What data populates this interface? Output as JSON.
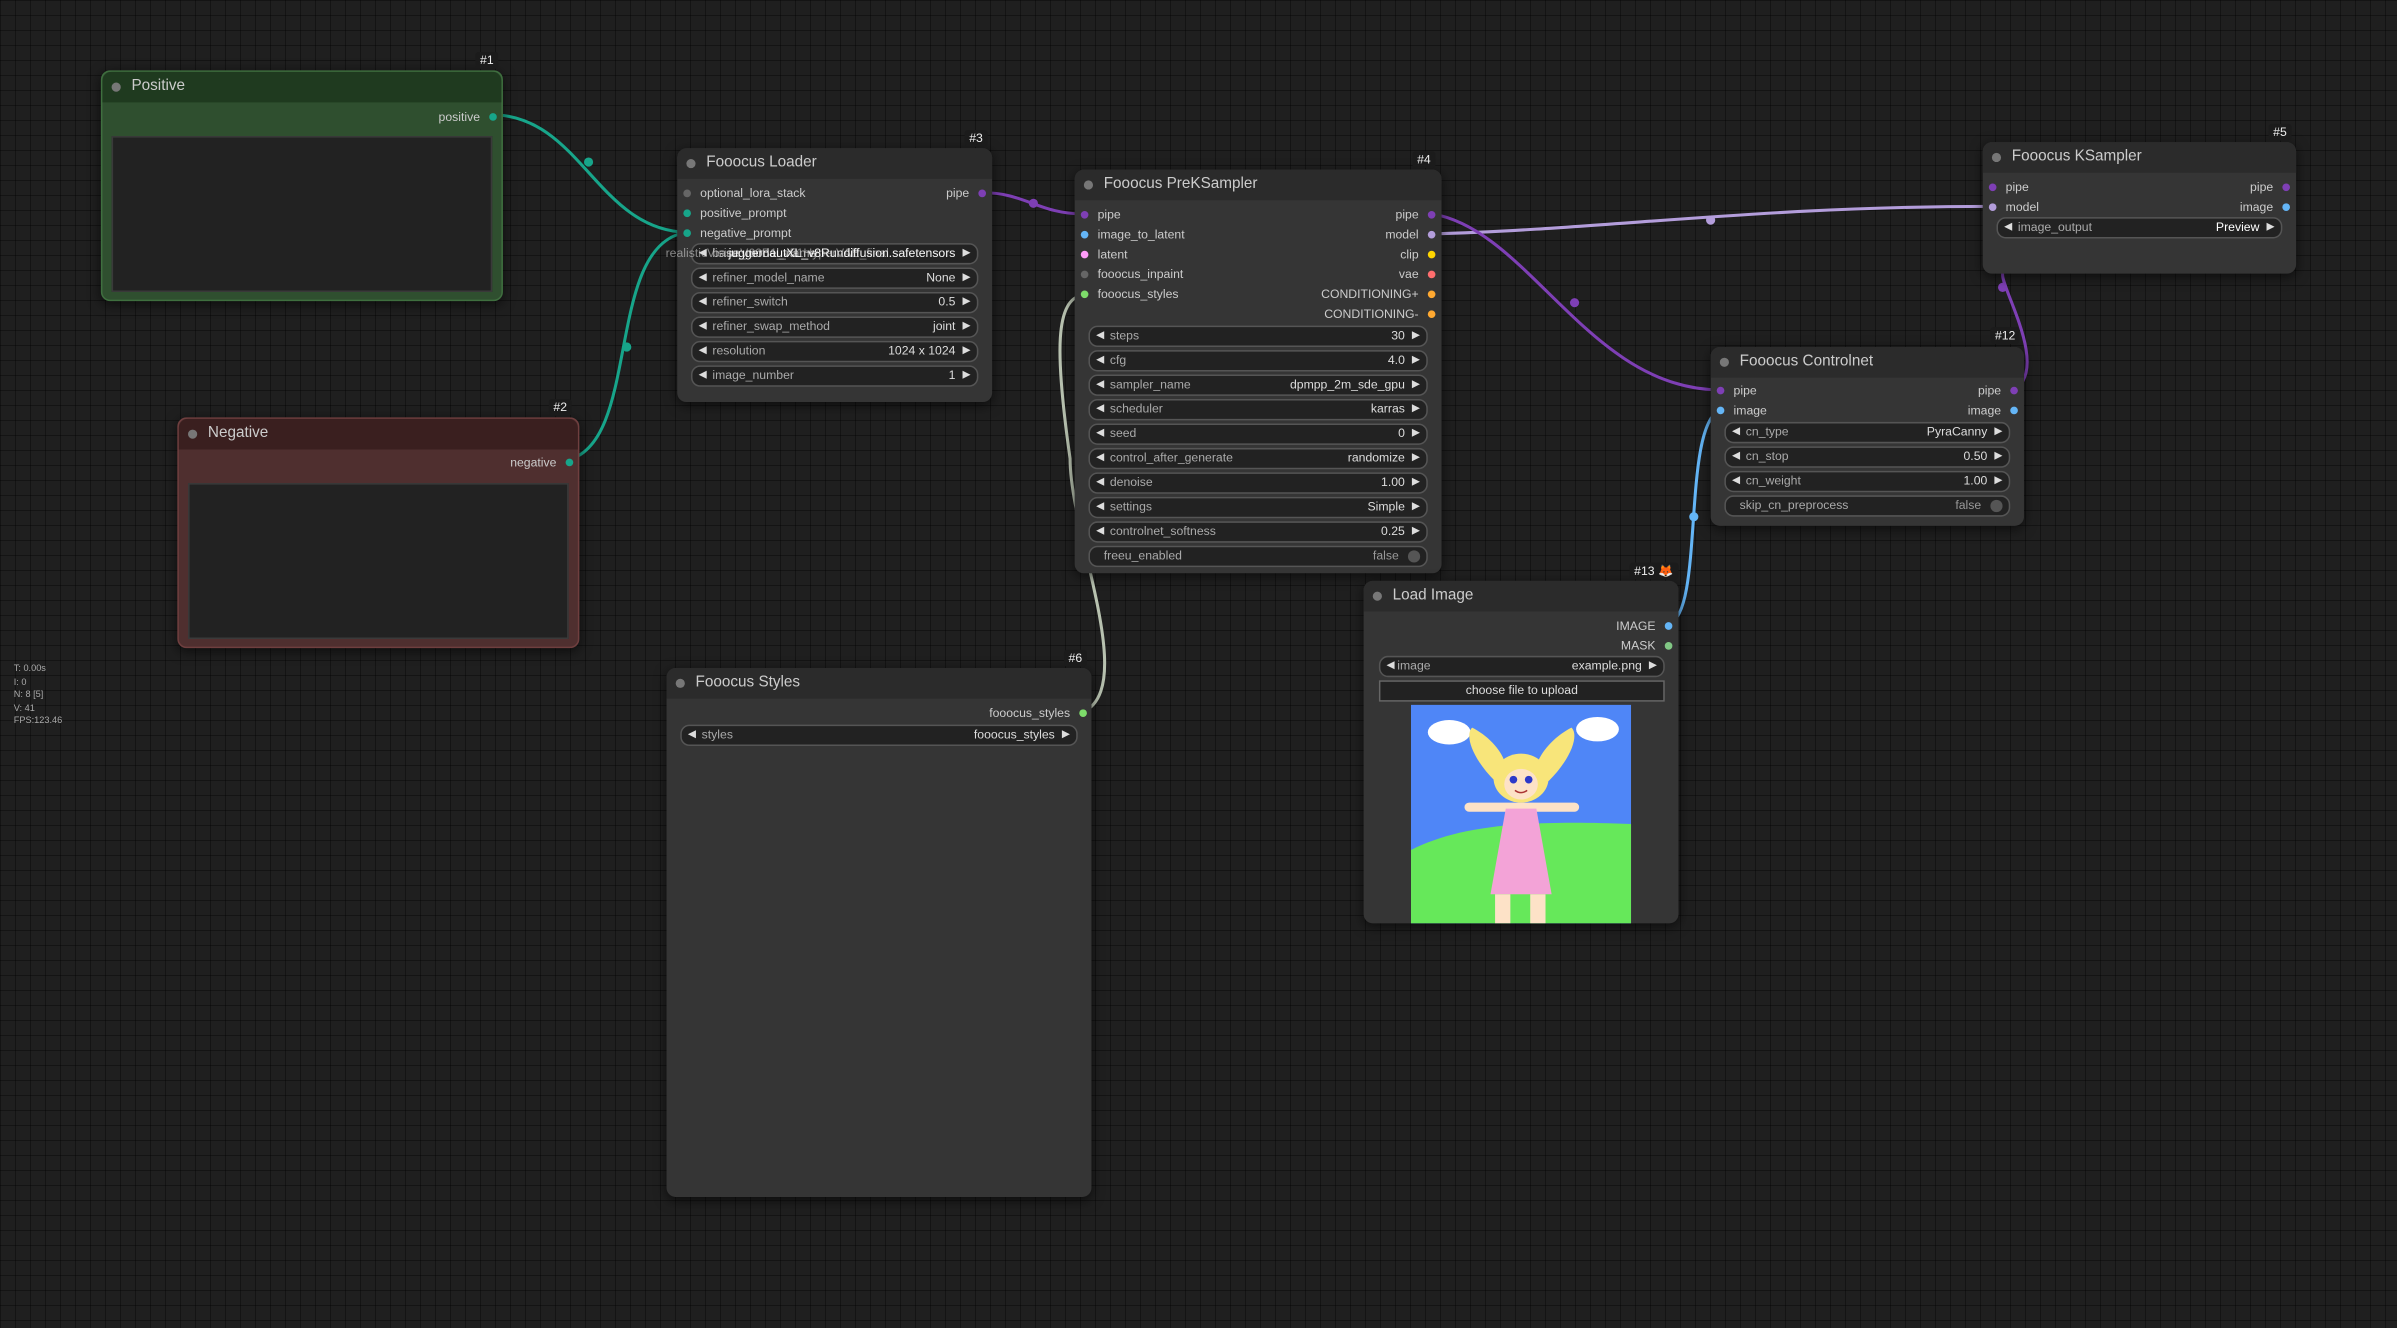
{
  "stats": [
    "T: 0.00s",
    "I: 0",
    "N: 8 [5]",
    "V: 41",
    "FPS:123.46"
  ],
  "colors": {
    "canvas": "#1f1f1f",
    "node": "#353535",
    "title": "#2b2b2b",
    "link_clip": "#17a58a",
    "link_pipe": "#7e3fb5",
    "link_model": "#b39ddb",
    "link_image": "#64b5f6",
    "link_styles": "#b8c2b0",
    "positive": "#2f4f2f",
    "negative": "#4f2f2f"
  },
  "nodes": {
    "positive": {
      "id": "#1",
      "title": "Positive",
      "outputs": [
        "positive"
      ]
    },
    "negative": {
      "id": "#2",
      "title": "Negative",
      "outputs": [
        "negative"
      ]
    },
    "loader": {
      "id": "#3",
      "title": "Fooocus Loader",
      "inputs": [
        "optional_lora_stack",
        "positive_prompt",
        "negative_prompt"
      ],
      "outputs": [
        "pipe"
      ],
      "widgets": [
        {
          "name": "base_model_name",
          "value": "juggernautXL_v8Rundiffusion.safetensors"
        },
        {
          "name": "refiner_model_name",
          "value": "None"
        },
        {
          "name": "refiner_switch",
          "value": "0.5"
        },
        {
          "name": "refiner_swap_method",
          "value": "joint"
        },
        {
          "name": "resolution",
          "value": "1024 x 1024"
        },
        {
          "name": "image_number",
          "value": "1"
        }
      ],
      "overlap_text": "realisticVisionV60B1_v51HyperVAE_final.safetensors"
    },
    "preksampler": {
      "id": "#4",
      "title": "Fooocus PreKSampler",
      "inputs": [
        "pipe",
        "image_to_latent",
        "latent",
        "fooocus_inpaint",
        "fooocus_styles"
      ],
      "outputs": [
        "pipe",
        "model",
        "clip",
        "vae",
        "CONDITIONING+",
        "CONDITIONING-"
      ],
      "widgets": [
        {
          "name": "steps",
          "value": "30"
        },
        {
          "name": "cfg",
          "value": "4.0"
        },
        {
          "name": "sampler_name",
          "value": "dpmpp_2m_sde_gpu"
        },
        {
          "name": "scheduler",
          "value": "karras"
        },
        {
          "name": "seed",
          "value": "0"
        },
        {
          "name": "control_after_generate",
          "value": "randomize"
        },
        {
          "name": "denoise",
          "value": "1.00"
        },
        {
          "name": "settings",
          "value": "Simple"
        },
        {
          "name": "controlnet_softness",
          "value": "0.25"
        }
      ],
      "toggle": {
        "name": "freeu_enabled",
        "value": "false"
      }
    },
    "ksampler": {
      "id": "#5",
      "title": "Fooocus KSampler",
      "inputs": [
        "pipe",
        "model"
      ],
      "outputs": [
        "pipe",
        "image"
      ],
      "widgets": [
        {
          "name": "image_output",
          "value": "Preview"
        }
      ]
    },
    "styles": {
      "id": "#6",
      "title": "Fooocus Styles",
      "outputs": [
        "fooocus_styles"
      ],
      "widgets": [
        {
          "name": "styles",
          "value": "fooocus_styles"
        }
      ]
    },
    "controlnet": {
      "id": "#12",
      "title": "Fooocus Controlnet",
      "inputs": [
        "pipe",
        "image"
      ],
      "outputs": [
        "pipe",
        "image"
      ],
      "widgets": [
        {
          "name": "cn_type",
          "value": "PyraCanny"
        },
        {
          "name": "cn_stop",
          "value": "0.50"
        },
        {
          "name": "cn_weight",
          "value": "1.00"
        }
      ],
      "toggle": {
        "name": "skip_cn_preprocess",
        "value": "false"
      }
    },
    "loadimage": {
      "id": "#13",
      "id_icon": "🦊",
      "title": "Load Image",
      "outputs": [
        "IMAGE",
        "MASK"
      ],
      "widgets": [
        {
          "name": "image",
          "value": "example.png"
        }
      ],
      "upload_label": "choose file to upload"
    }
  }
}
